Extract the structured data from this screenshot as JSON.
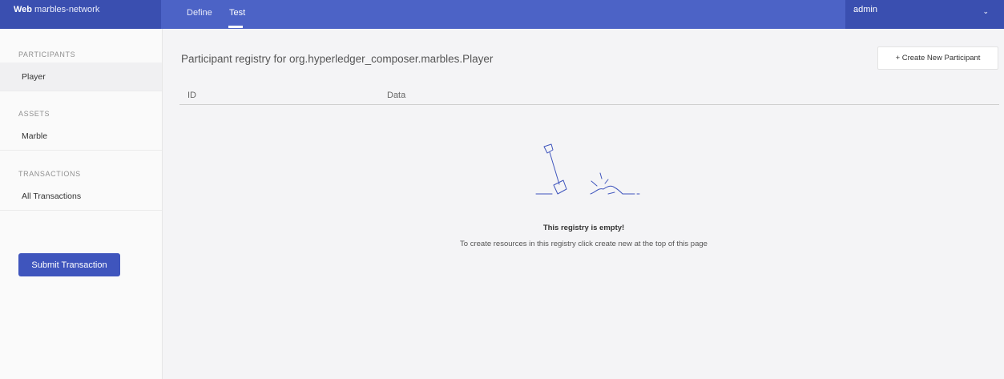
{
  "app": {
    "brand_bold": "Web",
    "brand_name": "marbles-network"
  },
  "topnav": {
    "tabs": [
      {
        "label": "Define",
        "active": false
      },
      {
        "label": "Test",
        "active": true
      }
    ],
    "user": "admin",
    "user_icon": "chevron-down-icon"
  },
  "sidebar": {
    "sections": [
      {
        "title": "PARTICIPANTS",
        "items": [
          {
            "label": "Player",
            "active": true
          }
        ]
      },
      {
        "title": "ASSETS",
        "items": [
          {
            "label": "Marble",
            "active": false
          }
        ]
      },
      {
        "title": "TRANSACTIONS",
        "items": [
          {
            "label": "All Transactions",
            "active": false
          }
        ]
      }
    ],
    "submit_label": "Submit Transaction"
  },
  "main": {
    "heading": "Participant registry for org.hyperledger_composer.marbles.Player",
    "create_label": "+ Create New Participant",
    "columns": [
      "ID",
      "Data"
    ],
    "empty_title": "This registry is empty!",
    "empty_message": "To create resources in this registry click create new at the top of this page",
    "empty_icon": "shovel-icon"
  },
  "colors": {
    "topbar": "#4c63c6",
    "topbar_dark": "#3a4fb0",
    "primary_button": "#3f55bd"
  }
}
